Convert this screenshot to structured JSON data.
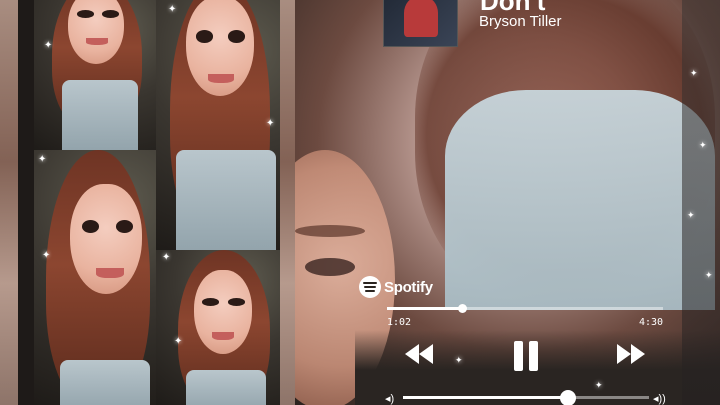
{
  "track": {
    "title": "Don't",
    "artist": "Bryson Tiller",
    "album_cover_icon": "album-cover"
  },
  "player": {
    "brand": "Spotify",
    "elapsed": "1:02",
    "duration": "4:30",
    "progress_fraction": 0.27,
    "volume_fraction": 0.67,
    "controls": [
      "rewind-icon",
      "pause-icon",
      "fast-forward-icon"
    ]
  },
  "colors": {
    "controls": "#ffffff",
    "background_dark": "#2a2220"
  }
}
